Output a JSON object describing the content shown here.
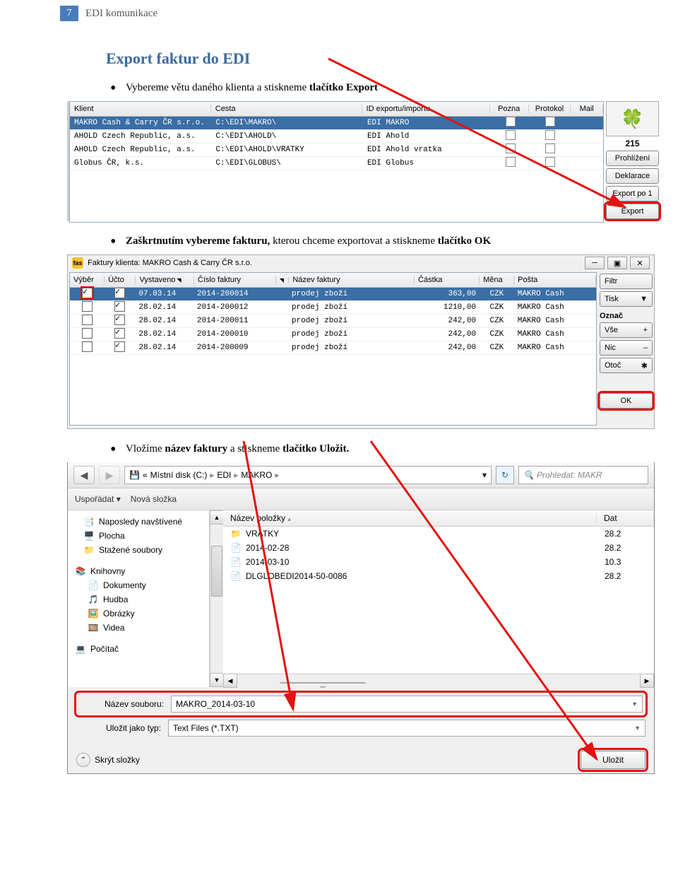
{
  "header": {
    "page_number": "7",
    "doc_title": "EDI komunikace"
  },
  "title": "Export faktur do EDI",
  "bullet1_prefix": "Vybereme větu daného klienta a stiskneme ",
  "bullet1_bold": "tlačítko Export",
  "bullet2_prefix": "Zaškrtnutím vybereme fakturu,",
  "bullet2_rest": " kterou chceme exportovat a stiskneme ",
  "bullet2_bold": "tlačítko OK",
  "bullet3_prefix": "Vložíme ",
  "bullet3_bold1": "název faktury",
  "bullet3_rest": " a stiskneme ",
  "bullet3_bold2": "tlačítko Uložit.",
  "clients": {
    "headers": {
      "klient": "Klient",
      "cesta": "Cesta",
      "id": "ID exportu/importu",
      "pozn": "Pozna",
      "prot": "Protokol",
      "mail": "Mail"
    },
    "rows": [
      {
        "klient": "MAKRO Cash & Carry ČR s.r.o.",
        "cesta": "C:\\EDI\\MAKRO\\",
        "id": "EDI MAKRO",
        "selected": true
      },
      {
        "klient": "AHOLD Czech Republic, a.s.",
        "cesta": "C:\\EDI\\AHOLD\\",
        "id": "EDI Ahold",
        "selected": false
      },
      {
        "klient": "AHOLD Czech Republic, a.s.",
        "cesta": "C:\\EDI\\AHOLD\\VRATKY",
        "id": "EDI Ahold vratka",
        "selected": false
      },
      {
        "klient": "Globus ČR, k.s.",
        "cesta": "C:\\EDI\\GLOBUS\\",
        "id": "EDI Globus",
        "selected": false
      }
    ]
  },
  "side_panel1": {
    "icon": "🍀",
    "count": "215",
    "buttons": {
      "prohlizeni": "Prohlížení",
      "deklarace": "Deklarace",
      "export1": "Export po 1",
      "export": "Export"
    }
  },
  "invoices": {
    "window_title": "Faktury klienta: MAKRO Cash & Carry ČR s.r.o.",
    "headers": {
      "vyber": "Výběr",
      "ucto": "Účto",
      "vystaveno": "Vystaveno",
      "cislo": "Číslo faktury",
      "nazev": "Název faktury",
      "castka": "Částka",
      "mena": "Měna",
      "posta": "Pošta"
    },
    "rows": [
      {
        "vyber": true,
        "ucto": true,
        "date": "07.03.14",
        "num": "2014-200014",
        "name": "prodej zboží",
        "amount": "363,00",
        "curr": "CZK",
        "post": "MAKRO Cash",
        "sel": true
      },
      {
        "vyber": false,
        "ucto": true,
        "date": "28.02.14",
        "num": "2014-200012",
        "name": "prodej zboží",
        "amount": "1210,00",
        "curr": "CZK",
        "post": "MAKRO Cash",
        "sel": false
      },
      {
        "vyber": false,
        "ucto": true,
        "date": "28.02.14",
        "num": "2014-200011",
        "name": "prodej zboží",
        "amount": "242,00",
        "curr": "CZK",
        "post": "MAKRO Cash",
        "sel": false
      },
      {
        "vyber": false,
        "ucto": true,
        "date": "28.02.14",
        "num": "2014-200010",
        "name": "prodej zboží",
        "amount": "242,00",
        "curr": "CZK",
        "post": "MAKRO Cash",
        "sel": false
      },
      {
        "vyber": false,
        "ucto": true,
        "date": "28.02.14",
        "num": "2014-200009",
        "name": "prodej zboží",
        "amount": "242,00",
        "curr": "CZK",
        "post": "MAKRO Cash",
        "sel": false
      }
    ]
  },
  "side_panel2": {
    "filtr": "Filtr",
    "tisk": "Tisk",
    "oznac_label": "Označ",
    "vse": "Vše",
    "nic": "Nic",
    "otoc": "Otoč",
    "ok": "OK",
    "plus": "+",
    "minus": "–",
    "star": "✱",
    "dd": "▼"
  },
  "save_dialog": {
    "breadcrumb": {
      "prefix": "«",
      "disk": "Místní disk (C:)",
      "a": "EDI",
      "b": "MAKRO",
      "sep": "▸",
      "dd": "▾"
    },
    "search_placeholder": "Prohledat: MAKR",
    "toolbar": {
      "usporadat": "Uspořádat ▾",
      "nova": "Nová složka"
    },
    "nav": {
      "recent": "Naposledy navštívené",
      "desktop": "Plocha",
      "downloads": "Stažené soubory",
      "libraries": "Knihovny",
      "documents": "Dokumenty",
      "music": "Hudba",
      "pictures": "Obrázky",
      "videos": "Videa",
      "computer": "Počítač"
    },
    "filelist": {
      "name_hdr": "Název položky",
      "date_hdr": "Dat",
      "rows": [
        {
          "icon": "folder",
          "name": "VRATKY",
          "date": "28.2"
        },
        {
          "icon": "file",
          "name": "2014-02-28",
          "date": "28.2"
        },
        {
          "icon": "file",
          "name": "2014-03-10",
          "date": "10.3"
        },
        {
          "icon": "file",
          "name": "DLGLOBEDI2014-50-0086",
          "date": "28.2"
        }
      ]
    },
    "filename_label": "Název souboru:",
    "filename_value": "MAKRO_2014-03-10",
    "filetype_label": "Uložit jako typ:",
    "filetype_value": "Text Files (*.TXT)",
    "hide_folders": "Skrýt složky",
    "save": "Uložit",
    "search_icon": "🔍"
  },
  "scroll_center_marker": "▪▪▪"
}
